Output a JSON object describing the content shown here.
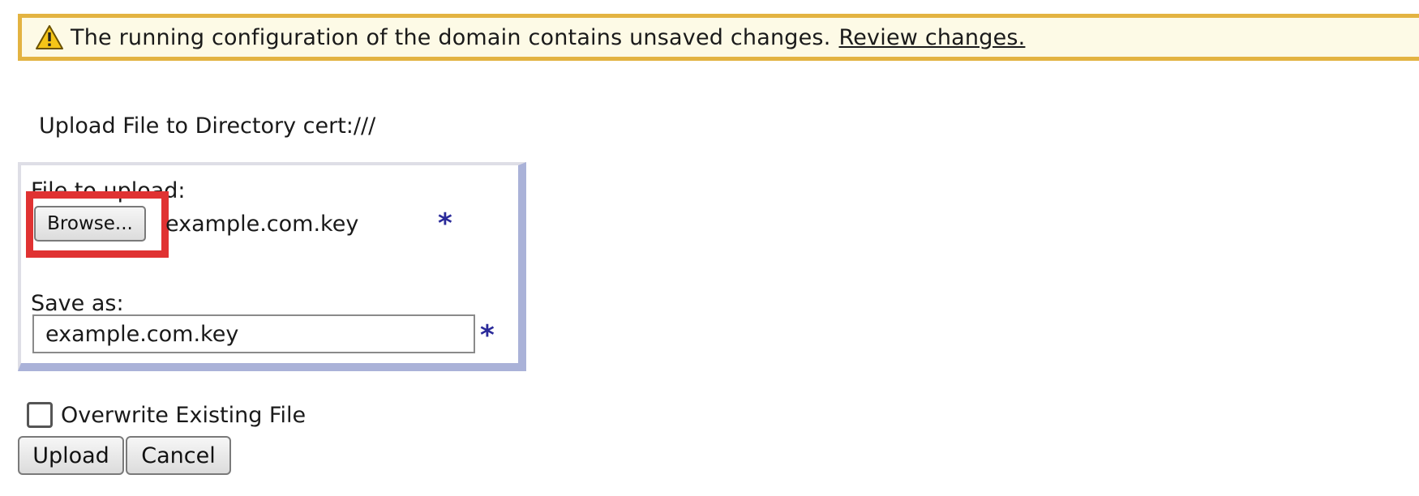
{
  "banner": {
    "message": "The running configuration of the domain contains unsaved changes.",
    "link_text": "Review changes.",
    "icon": "warning-triangle-icon",
    "border_color": "#e3b341",
    "background_color": "#fdfae6"
  },
  "upload_dialog": {
    "title": "Upload File to Directory cert:///",
    "file_label": "File to upload:",
    "browse_label": "Browse...",
    "selected_file": "example.com.key",
    "save_as_label": "Save as:",
    "save_as_value": "example.com.key",
    "required_marker": "*",
    "overwrite_label": "Overwrite Existing File",
    "overwrite_checked": false,
    "upload_label": "Upload",
    "cancel_label": "Cancel",
    "highlight_color": "#e03232",
    "panel_accent_color": "#aab2d8"
  }
}
